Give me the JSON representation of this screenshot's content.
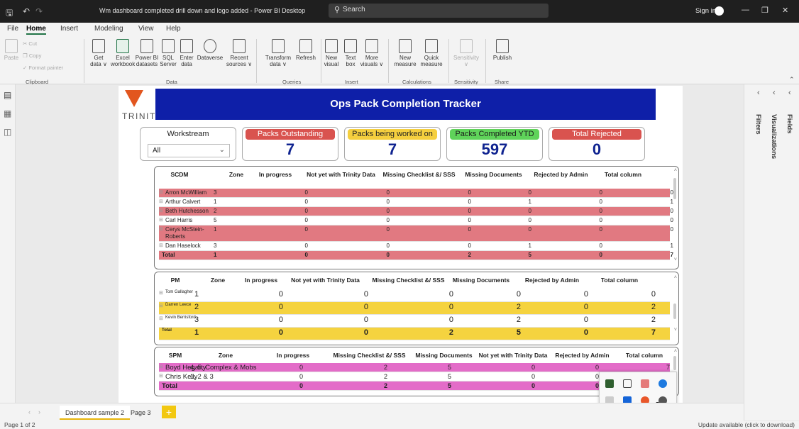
{
  "titlebar": {
    "title": "Wm dashboard completed drill down and logo added - Power BI Desktop",
    "search_placeholder": "Search",
    "signin": "Sign in"
  },
  "menu": [
    "File",
    "Home",
    "Insert",
    "Modeling",
    "View",
    "Help"
  ],
  "ribbon": {
    "clipboard": {
      "paste": "Paste",
      "cut": "Cut",
      "copy": "Copy",
      "format_painter": "Format painter",
      "group": "Clipboard"
    },
    "data": {
      "get_data": [
        "Get",
        "data ∨"
      ],
      "excel": [
        "Excel",
        "workbook"
      ],
      "powerbi": [
        "Power BI",
        "datasets"
      ],
      "sql": [
        "SQL",
        "Server"
      ],
      "enter": [
        "Enter",
        "data"
      ],
      "dataverse": [
        "Dataverse",
        ""
      ],
      "recent": [
        "Recent",
        "sources ∨"
      ],
      "group": "Data"
    },
    "queries": {
      "transform": [
        "Transform",
        "data ∨"
      ],
      "refresh": [
        "Refresh",
        ""
      ],
      "group": "Queries"
    },
    "insert": {
      "new_visual": [
        "New",
        "visual"
      ],
      "text_box": [
        "Text",
        "box"
      ],
      "more_visuals": [
        "More",
        "visuals ∨"
      ],
      "group": "Insert"
    },
    "calculations": {
      "new_measure": [
        "New",
        "measure"
      ],
      "quick_measure": [
        "Quick",
        "measure"
      ],
      "group": "Calculations"
    },
    "sensitivity": {
      "label": [
        "Sensitivity",
        "∨"
      ],
      "group": "Sensitivity"
    },
    "share": {
      "publish": [
        "Publish",
        ""
      ],
      "group": "Share"
    }
  },
  "report": {
    "logo_text": "TRINITY",
    "banner": "Ops Pack Completion Tracker",
    "workstream": {
      "label": "Workstream",
      "value": "All"
    },
    "kpis": [
      {
        "label": "Packs Outstanding",
        "value": "7",
        "bg": "#d9534f",
        "fg": "#ffffff"
      },
      {
        "label": "Packs being worked on",
        "value": "7",
        "bg": "#f5cf3e",
        "fg": "#222222"
      },
      {
        "label": "Packs Completed YTD",
        "value": "597",
        "bg": "#5fd35a",
        "fg": "#1a1a1a"
      },
      {
        "label": "Total Rejected",
        "value": "0",
        "bg": "#d9534f",
        "fg": "#ffffff"
      }
    ],
    "scdm": {
      "headers": [
        "SCDM",
        "Zone",
        "In progress",
        "Not yet with Trinity Data",
        "Missing Checklist &/ SSS",
        "Missing Documents",
        "Rejected by Admin",
        "Total column"
      ],
      "rows": [
        {
          "name": "Arron McWilliam",
          "zone": "3",
          "v": [
            "0",
            "0",
            "0",
            "0",
            "0",
            "0"
          ],
          "hl": true
        },
        {
          "name": "Arthur Calvert",
          "zone": "1",
          "v": [
            "0",
            "0",
            "0",
            "1",
            "0",
            "1"
          ],
          "hl": false
        },
        {
          "name": "Beth Hutchesson",
          "zone": "2",
          "v": [
            "0",
            "0",
            "0",
            "0",
            "0",
            "0"
          ],
          "hl": true
        },
        {
          "name": "Carl Harris",
          "zone": "5",
          "v": [
            "0",
            "0",
            "0",
            "0",
            "0",
            "0"
          ],
          "hl": false
        },
        {
          "name": "Cerys McStein-",
          "name2": "Roberts",
          "zone": "1",
          "v": [
            "0",
            "0",
            "0",
            "0",
            "0",
            "0"
          ],
          "hl": true
        },
        {
          "name": "Dan Haselock",
          "zone": "3",
          "v": [
            "0",
            "0",
            "0",
            "1",
            "0",
            "1"
          ],
          "hl": false
        }
      ],
      "total": {
        "name": "Total",
        "zone": "1",
        "v": [
          "0",
          "0",
          "2",
          "5",
          "0",
          "7"
        ]
      },
      "color": "#e17981"
    },
    "pm": {
      "headers": [
        "PM",
        "Zone",
        "In progress",
        "Not yet with Trinity Data",
        "Missing Checklist &/ SSS",
        "Missing Documents",
        "Rejected by Admin",
        "Total column"
      ],
      "rows": [
        {
          "name": "Tom Gallagher",
          "zone": "1",
          "v": [
            "0",
            "0",
            "0",
            "0",
            "0",
            "0"
          ],
          "hl": false
        },
        {
          "name": "Darren Leece",
          "zone": "2",
          "v": [
            "0",
            "0",
            "0",
            "2",
            "0",
            "2"
          ],
          "hl": true
        },
        {
          "name": "Kevin Berrisford",
          "zone": "3",
          "v": [
            "0",
            "0",
            "0",
            "2",
            "0",
            "2"
          ],
          "hl": false
        }
      ],
      "total": {
        "name": "Total",
        "zone": "1",
        "v": [
          "0",
          "0",
          "2",
          "5",
          "0",
          "7"
        ]
      },
      "color": "#f5d33f"
    },
    "spm": {
      "headers": [
        "SPM",
        "Zone",
        "In progress",
        "Missing Checklist &/ SSS",
        "Missing Documents",
        "Not yet with Trinity Data",
        "Rejected by Admin",
        "Total column"
      ],
      "rows": [
        {
          "name": "Boyd Hegarty",
          "zone": "4, 5, Complex & Mobs",
          "v": [
            "0",
            "2",
            "5",
            "0",
            "0",
            "7"
          ],
          "hl": true
        },
        {
          "name": "Chris Kelly",
          "zone": "1, 2 & 3",
          "v": [
            "0",
            "2",
            "5",
            "0",
            "0",
            ""
          ],
          "hl": false
        }
      ],
      "total": {
        "name": "Total",
        "zone": "",
        "v": [
          "0",
          "2",
          "5",
          "0",
          "0",
          ""
        ]
      },
      "color": "#e36cc8"
    }
  },
  "right_panel": [
    "Filters",
    "Visualizations",
    "Fields"
  ],
  "pages": [
    "Dashboard sample 2",
    "Page 3"
  ],
  "status": {
    "page": "Page 1 of 2",
    "update": "Update available (click to download)"
  }
}
